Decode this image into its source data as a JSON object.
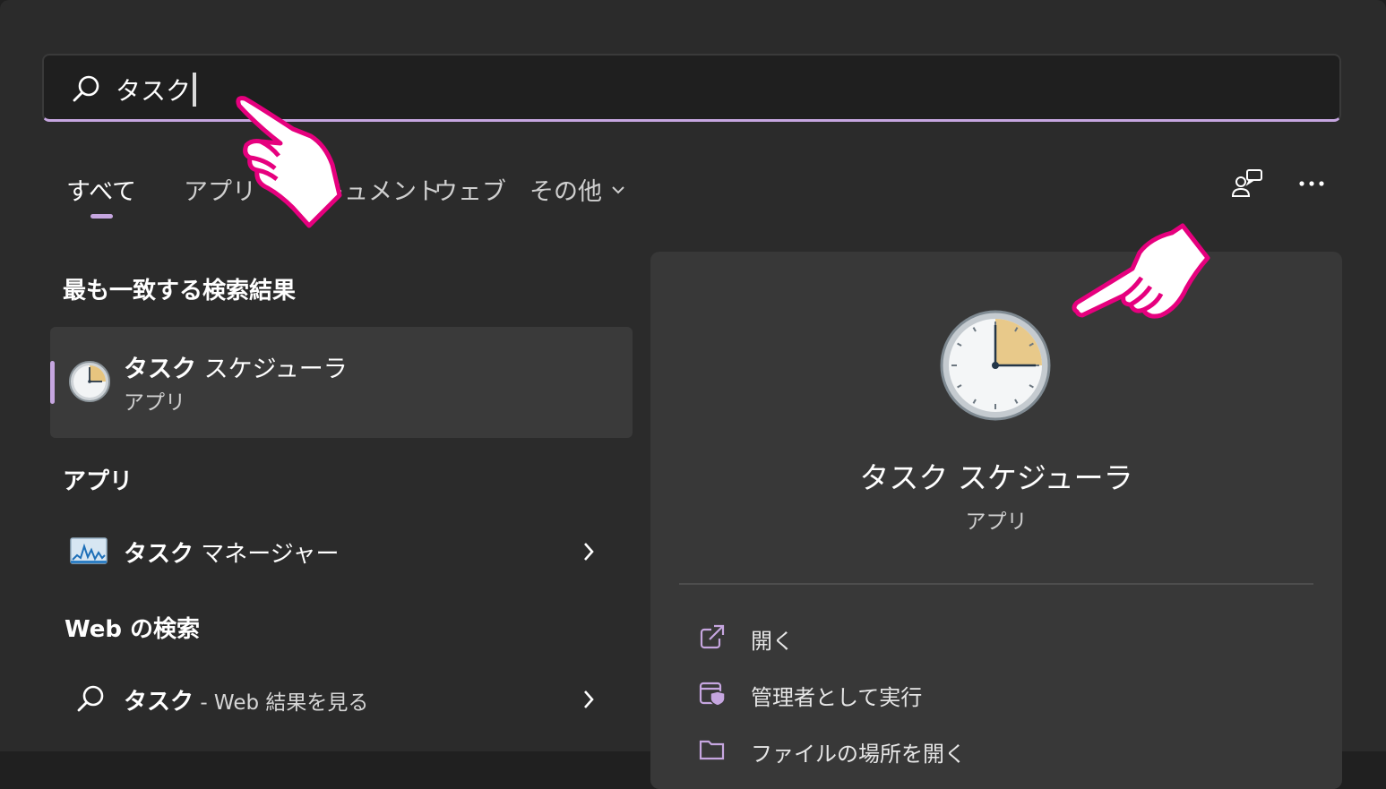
{
  "search": {
    "query": "タスク"
  },
  "tabs": [
    {
      "label": "すべて",
      "active": true
    },
    {
      "label": "アプリ"
    },
    {
      "label": "ドキュメント"
    },
    {
      "label": "ウェブ"
    },
    {
      "label": "その他"
    }
  ],
  "toolbar": {
    "people_icon": "people-chat-icon",
    "more_icon": "more-dots-icon"
  },
  "best_match": {
    "title": "最も一致する検索結果",
    "name_bold": "タスク",
    "name_rest": " スケジューラ",
    "type": "アプリ",
    "icon": "clock-icon"
  },
  "apps_section": {
    "title": "アプリ",
    "items": [
      {
        "name_bold": "タスク",
        "name_rest": " マネージャー",
        "icon": "task-manager-icon"
      }
    ]
  },
  "web_section": {
    "title": "Web の検索",
    "query_bold": "タスク",
    "suffix": " - Web 結果を見る"
  },
  "detail": {
    "name": "タスク スケジューラ",
    "type": "アプリ",
    "actions": [
      {
        "label": "開く",
        "icon": "open-external-icon"
      },
      {
        "label": "管理者として実行",
        "icon": "admin-shield-icon"
      },
      {
        "label": "ファイルの場所を開く",
        "icon": "folder-icon"
      }
    ]
  },
  "colors": {
    "accent": "#c6a6e0",
    "annotation": "#e6007e",
    "panel": "#2b2b2b",
    "detail_panel": "#383838"
  }
}
